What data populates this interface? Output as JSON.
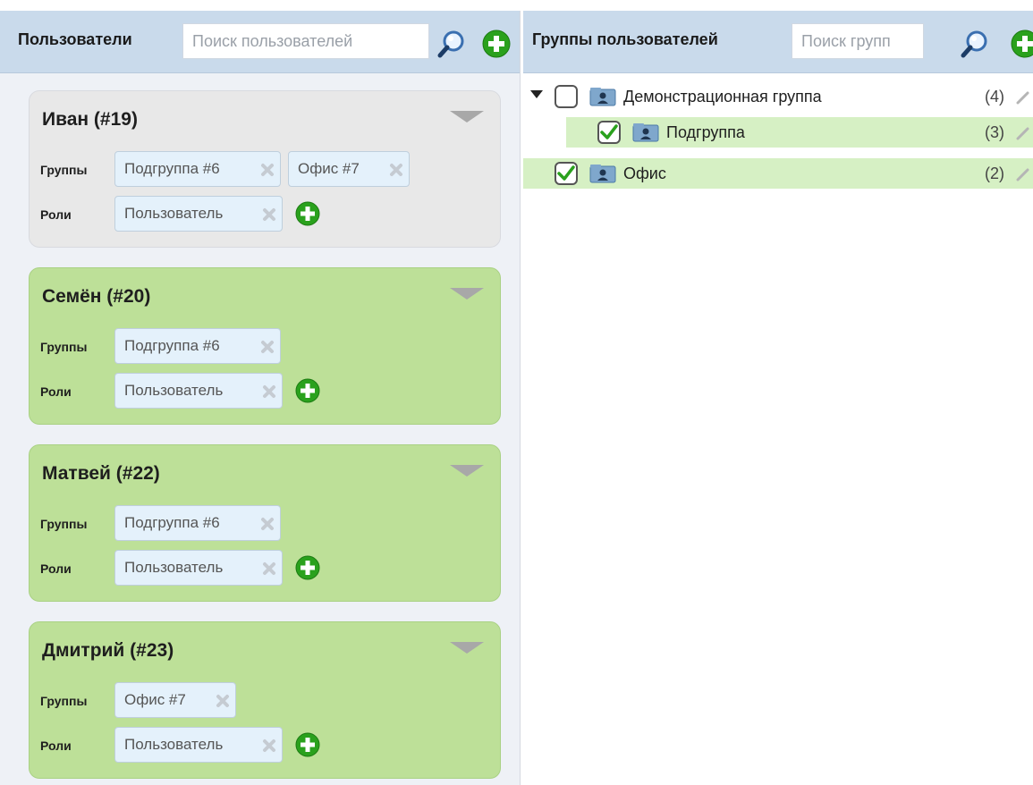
{
  "users_panel": {
    "title": "Пользователи",
    "search_placeholder": "Поиск пользователей",
    "groups_label": "Группы",
    "roles_label": "Роли",
    "users": [
      {
        "name": "Иван (#19)",
        "selected": false,
        "groups": [
          "Подгруппа #6",
          "Офис #7"
        ],
        "roles": [
          "Пользователь"
        ]
      },
      {
        "name": "Семён (#20)",
        "selected": true,
        "groups": [
          "Подгруппа #6"
        ],
        "roles": [
          "Пользователь"
        ]
      },
      {
        "name": "Матвей (#22)",
        "selected": true,
        "groups": [
          "Подгруппа #6"
        ],
        "roles": [
          "Пользователь"
        ]
      },
      {
        "name": "Дмитрий (#23)",
        "selected": true,
        "groups": [
          "Офис #7"
        ],
        "roles": [
          "Пользователь"
        ]
      }
    ]
  },
  "groups_panel": {
    "title": "Группы пользователей",
    "search_placeholder": "Поиск групп",
    "groups": [
      {
        "name": "Демонстрационная группа",
        "count": "(4)",
        "checked": false,
        "expanded": true
      },
      {
        "name": "Подгруппа",
        "count": "(3)",
        "checked": true
      },
      {
        "name": "Офис",
        "count": "(2)",
        "checked": true
      }
    ]
  },
  "icons": {
    "search": "search-icon",
    "add": "add-icon",
    "remove": "remove-icon",
    "collapse": "collapse-arrow-icon",
    "group": "user-group-icon",
    "edit": "edit-icon"
  },
  "colors": {
    "header_bg": "#c9daeb",
    "selected_card": "#bde098",
    "default_card": "#e8e8e8",
    "chip_bg": "#e4f1fb",
    "add_green": "#2aa11d",
    "tree_highlight": "#d6f0c4"
  }
}
